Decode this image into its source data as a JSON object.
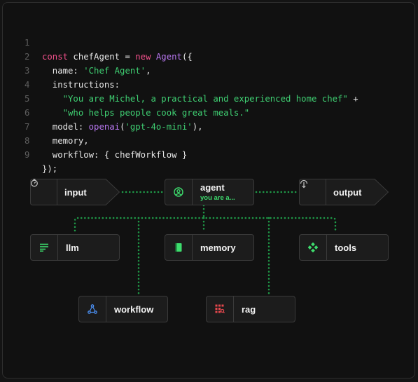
{
  "code": {
    "line_numbers": [
      "1",
      "2",
      "3",
      "4",
      "5",
      "6",
      "7",
      "8",
      "9"
    ],
    "line1": {
      "kw1": "const ",
      "name": "chefAgent",
      "eq": " = ",
      "kw2": "new ",
      "cls": "Agent",
      "open": "({"
    },
    "line2": {
      "prop": "  name",
      "colon": ": ",
      "val": "'Chef Agent'",
      "comma": ","
    },
    "line3": {
      "prop": "  instructions",
      "colon": ":"
    },
    "line4": {
      "indent": "    ",
      "val": "\"You are Michel, a practical and experienced home chef\"",
      "plus": " +"
    },
    "line5": {
      "indent": "    ",
      "val": "\"who helps people cook great meals.\""
    },
    "line6": {
      "prop": "  model",
      "colon": ": ",
      "fn": "openai",
      "open": "(",
      "val": "'gpt-4o-mini'",
      "close": "),"
    },
    "line7": {
      "prop": "  memory",
      "comma": ","
    },
    "line8": {
      "prop": "  workflow",
      "rest": ": { chefWorkflow }"
    },
    "line9": {
      "text": "});"
    }
  },
  "diagram": {
    "input": {
      "label": "input",
      "icon": "stopwatch-icon"
    },
    "agent": {
      "label": "agent",
      "sublabel": "you are a...",
      "icon": "user-circle-icon"
    },
    "output": {
      "label": "output",
      "icon": "export-icon"
    },
    "llm": {
      "label": "llm",
      "icon": "text-lines-icon"
    },
    "memory": {
      "label": "memory",
      "icon": "book-icon"
    },
    "tools": {
      "label": "tools",
      "icon": "grid-dots-icon"
    },
    "workflow": {
      "label": "workflow",
      "icon": "branch-icon"
    },
    "rag": {
      "label": "rag",
      "icon": "grid-search-icon"
    },
    "colors": {
      "accent_green": "#3ddc6d",
      "wire": "#1f9a48",
      "rag_red": "#e5484d",
      "workflow_blue": "#4a8ef0"
    }
  }
}
